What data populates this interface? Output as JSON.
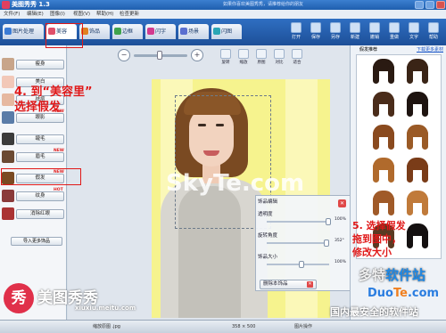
{
  "window": {
    "title": "美图秀秀 1.3",
    "center_text": "如果你喜欢美图秀秀，请推荐给你的朋友"
  },
  "menu": [
    "文件(F)",
    "编辑(E)",
    "图像(I)",
    "视图(V)",
    "帮助(H)",
    "检查更新"
  ],
  "tabs": [
    {
      "label": "图片处理",
      "color": "#3a7bd5"
    },
    {
      "label": "美容",
      "color": "#e0506a"
    },
    {
      "label": "饰品",
      "color": "#e08020"
    },
    {
      "label": "边框",
      "color": "#3fa34d"
    },
    {
      "label": "闪字",
      "color": "#d23a8f"
    },
    {
      "label": "场景",
      "color": "#5a6fd0"
    },
    {
      "label": "闪图",
      "color": "#2aa6b5"
    }
  ],
  "toolbar_right": [
    "打开",
    "保存",
    "另存",
    "新建",
    "撤销",
    "重做",
    "文字",
    "帮助"
  ],
  "left_panel": {
    "items": [
      {
        "label": "瘦身",
        "new": "",
        "thumb": "#c8a58a"
      },
      {
        "label": "美白",
        "new": "",
        "thumb": "#f2c8b8"
      },
      {
        "label": "祛痘",
        "new": "",
        "thumb": "#e6b8a0"
      },
      {
        "label": "眼影",
        "new": "NEW",
        "thumb": "#5a7ca8"
      },
      {
        "label": "睫毛",
        "new": "",
        "thumb": "#3b3b3b"
      },
      {
        "label": "眉毛",
        "new": "NEW",
        "thumb": "#6b4a33"
      },
      {
        "label": "假发",
        "new": "NEW",
        "thumb": "#7a4a22"
      },
      {
        "label": "纹身",
        "new": "HOT",
        "thumb": "#8a3a3a"
      },
      {
        "label": "消除红眼",
        "new": "",
        "thumb": "#a33"
      }
    ],
    "import_label": "导入更多饰品"
  },
  "canvas_tools": [
    "旋转",
    "缩放",
    "原图",
    "对比",
    "适合"
  ],
  "edit_panel": {
    "title": "饰品编辑",
    "rows": [
      {
        "label": "透明度",
        "pct": "100%",
        "level": 1.0
      },
      {
        "label": "旋转角度",
        "pct": "352°",
        "level": 0.98
      },
      {
        "label": "饰品大小",
        "pct": "100%",
        "level": 0.55
      }
    ],
    "delete_label": "删除本饰品"
  },
  "right_panel": {
    "header": "假发推荐",
    "more_link": "下载更多素材"
  },
  "wigs": [
    {
      "color": "#2a1a12"
    },
    {
      "color": "#3a2416"
    },
    {
      "color": "#4a2c1a"
    },
    {
      "color": "#1e1410"
    },
    {
      "color": "#8a4a1e"
    },
    {
      "color": "#9a5a26"
    },
    {
      "color": "#b06a2c"
    },
    {
      "color": "#7a3c18"
    },
    {
      "color": "#a05a28"
    },
    {
      "color": "#c07a3a"
    },
    {
      "color": "#5a3a22"
    },
    {
      "color": "#141010"
    }
  ],
  "status": {
    "left": "缩放原图 .jpg",
    "size": "358 × 500",
    "right": "图片操作"
  },
  "brand": {
    "name": "美图秀秀",
    "url": "xiuxiu.meitu.com",
    "seal": "秀"
  },
  "annotations": {
    "step4_line1": "4. 到“美容里”",
    "step4_line2": "选择假发",
    "step5_line1": "5. 选择假发",
    "step5_line2": "拖到图中，",
    "step5_line3": "修改大小"
  },
  "watermarks": {
    "photo_mark": "SkyTe.com",
    "site_cn_a": "多特",
    "site_cn_b": "软件站",
    "site_en_a": "Duo",
    "site_en_b": "Te",
    "site_en_c": ".com",
    "slogan": "国内最安全的软件站"
  }
}
